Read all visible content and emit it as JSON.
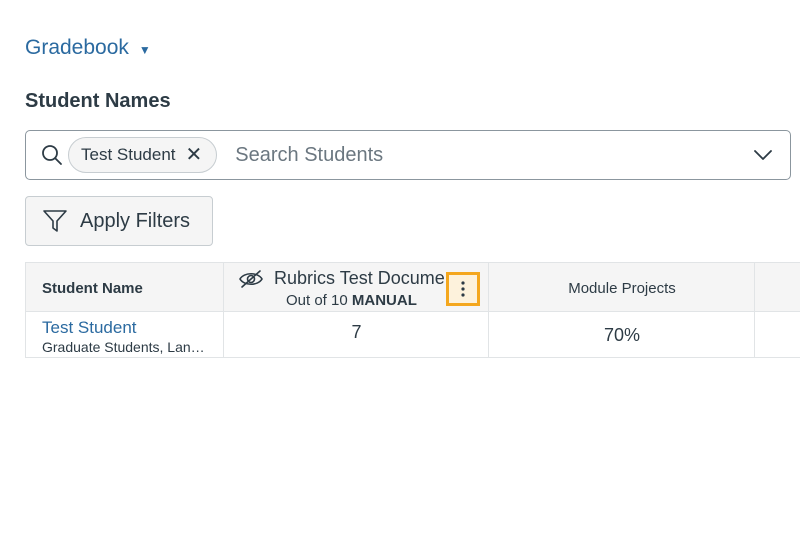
{
  "gradebook_menu": {
    "label": "Gradebook"
  },
  "section_title": "Student Names",
  "search": {
    "chip_label": "Test Student",
    "placeholder": "Search Students"
  },
  "apply_filters": {
    "label": "Apply Filters"
  },
  "grid": {
    "headers": {
      "student": "Student Name",
      "assignment_name": "Rubrics Test Docume",
      "assignment_points": "Out of 10",
      "assignment_type": "MANUAL",
      "module": "Module Projects"
    },
    "rows": [
      {
        "student_name": "Test Student",
        "sections": "Graduate Students, Lan…",
        "assignment_score": "7",
        "module_grade": "70%"
      }
    ]
  },
  "colors": {
    "link": "#2b6aa0",
    "focus_outline": "#f4a71e",
    "header_bg": "#f5f5f5"
  }
}
